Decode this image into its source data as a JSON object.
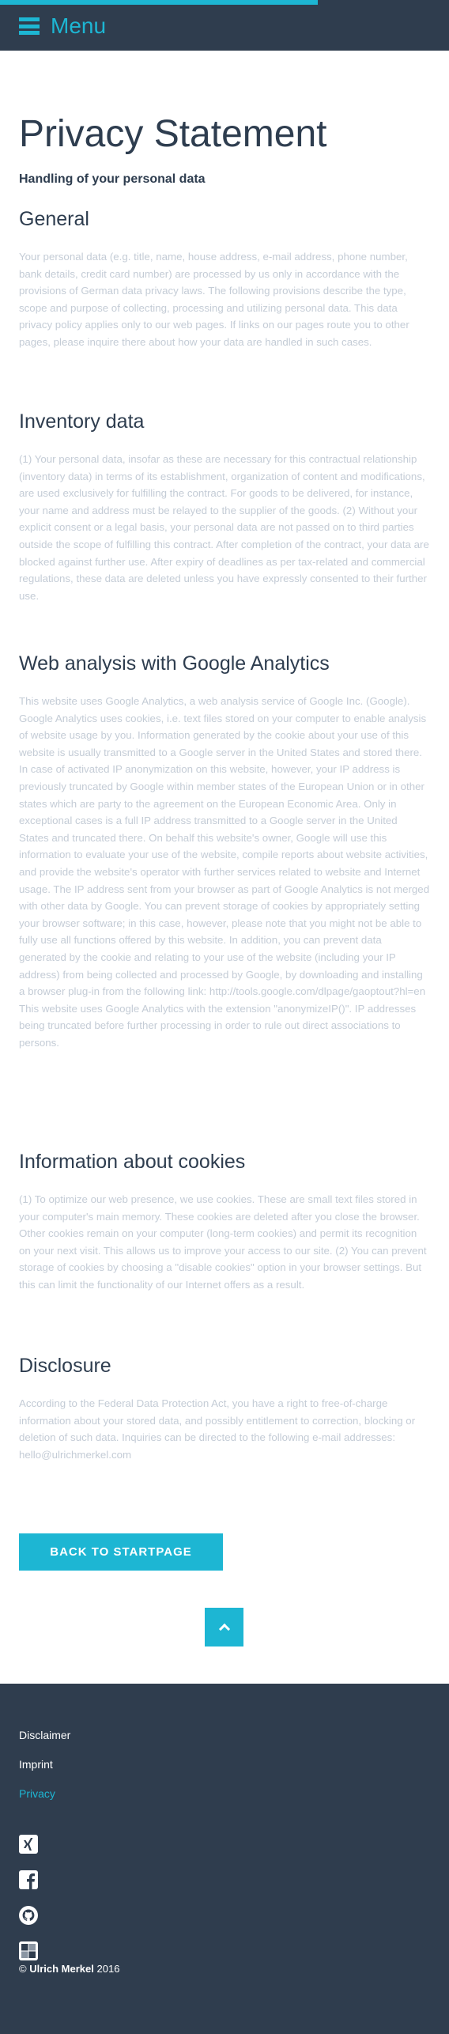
{
  "header": {
    "menu_label": "Menu"
  },
  "page": {
    "title": "Privacy Statement",
    "subtitle": "Handling of your personal data"
  },
  "sections": [
    {
      "heading": "General",
      "text": "Your personal data (e.g. title, name, house address, e-mail address, phone number, bank details, credit card number) are processed by us only in accordance with the provisions of German data privacy laws. The following provisions describe the type, scope and purpose of collecting, processing and utilizing personal data. This data privacy policy applies only to our web pages. If links on our pages route you to other pages, please inquire there about how your data are handled in such cases."
    },
    {
      "heading": "Inventory data",
      "text": "(1) Your personal data, insofar as these are necessary for this contractual relationship (inventory data) in terms of its establishment, organization of content and modifications, are used exclusively for fulfilling the contract. For goods to be delivered, for instance, your name and address must be relayed to the supplier of the goods. (2) Without your explicit consent or a legal basis, your personal data are not passed on to third parties outside the scope of fulfilling this contract. After completion of the contract, your data are blocked against further use. After expiry of deadlines as per tax-related and commercial regulations, these data are deleted unless you have expressly consented to their further use."
    },
    {
      "heading": "Web analysis with Google Analytics",
      "text": "This website uses Google Analytics, a web analysis service of Google Inc. (Google). Google Analytics uses cookies, i.e. text files stored on your computer to enable analysis of website usage by you. Information generated by the cookie about your use of this website is usually transmitted to a Google server in the United States and stored there. In case of activated IP anonymization on this website, however, your IP address is previously truncated by Google within member states of the European Union or in other states which are party to the agreement on the European Economic Area. Only in exceptional cases is a full IP address transmitted to a Google server in the United States and truncated there. On behalf this website's owner, Google will use this information to evaluate your use of the website, compile reports about website activities, and provide the website's operator with further services related to website and Internet usage. The IP address sent from your browser as part of Google Analytics is not merged with other data by Google. You can prevent storage of cookies by appropriately setting your browser software; in this case, however, please note that you might not be able to fully use all functions offered by this website. In addition, you can prevent data generated by the cookie and relating to your use of the website (including your IP address) from being collected and processed by Google, by downloading and installing a browser plug-in from the following link: http://tools.google.com/dlpage/gaoptout?hl=en This website uses Google Analytics with the extension \"anonymizeIP()\". IP addresses being truncated before further processing in order to rule out direct associations to persons."
    },
    {
      "heading": "Information about cookies",
      "text": "(1) To optimize our web presence, we use cookies. These are small text files stored in your computer's main memory. These cookies are deleted after you close the browser. Other cookies remain on your computer (long-term cookies) and permit its recognition on your next visit. This allows us to improve your access to our site. (2) You can prevent storage of cookies by choosing a \"disable cookies\" option in your browser settings. But this can limit the functionality of our Internet offers as a result."
    },
    {
      "heading": "Disclosure",
      "text": "According to the Federal Data Protection Act, you have a right to free-of-charge information about your stored data, and possibly entitlement to correction, blocking or deletion of such data. Inquiries can be directed to the following e-mail addresses: hello@ulrichmerkel.com"
    }
  ],
  "buttons": {
    "back_label": "BACK TO STARTPAGE"
  },
  "footer": {
    "links": [
      "Disclaimer",
      "Imprint",
      "Privacy"
    ],
    "social": [
      "xing-icon",
      "facebook-icon",
      "github-icon",
      "delicious-icon"
    ],
    "copyright_symbol": "©",
    "copyright_name": "Ulrich Merkel",
    "copyright_year": "2016"
  },
  "colors": {
    "accent": "#1db6d3",
    "dark": "#2f3d4e",
    "body_text": "#c4ccd6"
  }
}
